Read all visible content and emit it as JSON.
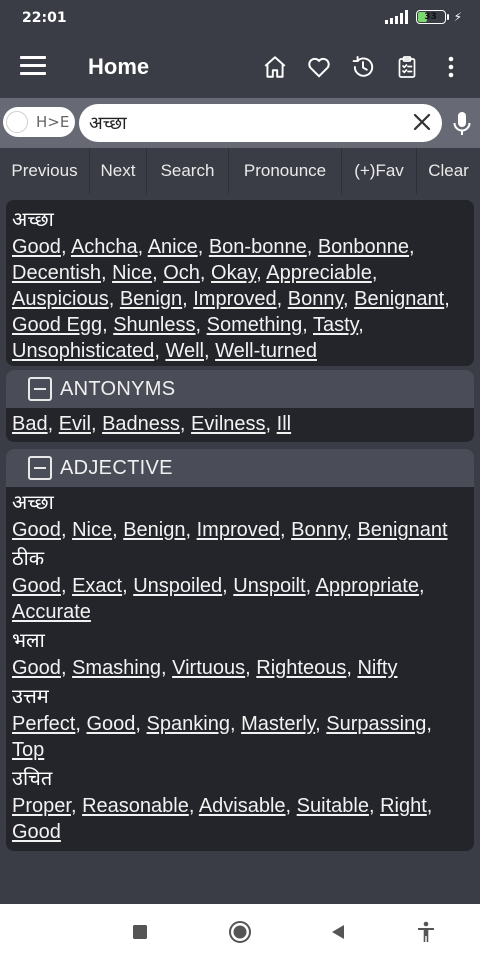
{
  "status": {
    "time": "22:01",
    "battery": "33",
    "battery_level": 0.33
  },
  "appbar": {
    "title": "Home"
  },
  "search": {
    "toggle_label": "H>E",
    "value": "अच्छा"
  },
  "tabs": [
    {
      "label": "Previous"
    },
    {
      "label": "Next"
    },
    {
      "label": "Search"
    },
    {
      "label": "Pronounce"
    },
    {
      "label": "(+)Fav"
    },
    {
      "label": "Clear"
    }
  ],
  "main": {
    "headword": "अच्छा",
    "translations": [
      "Good",
      "Achcha",
      "Anice",
      "Bon-bonne",
      "Bonbonne",
      "Decentish",
      "Nice",
      "Och",
      "Okay",
      "Appreciable",
      "Auspicious",
      "Benign",
      "Improved",
      "Bonny",
      "Benignant",
      "Good Egg",
      "Shunless",
      "Something",
      "Tasty",
      "Unsophisticated",
      "Well",
      "Well-turned"
    ]
  },
  "antonyms": {
    "heading": "ANTONYMS",
    "words": [
      "Bad",
      "Evil",
      "Badness",
      "Evilness",
      "Ill"
    ]
  },
  "adjective": {
    "heading": "ADJECTIVE",
    "groups": [
      {
        "hindi": "अच्छा",
        "words": [
          "Good",
          "Nice",
          "Benign",
          "Improved",
          "Bonny",
          "Benignant"
        ]
      },
      {
        "hindi": "ठीक",
        "words": [
          "Good",
          "Exact",
          "Unspoiled",
          "Unspoilt",
          "Appropriate",
          "Accurate"
        ]
      },
      {
        "hindi": "भला",
        "words": [
          "Good",
          "Smashing",
          "Virtuous",
          "Righteous",
          "Nifty"
        ]
      },
      {
        "hindi": "उत्तम",
        "words": [
          "Perfect",
          "Good",
          "Spanking",
          "Masterly",
          "Surpassing",
          "Top"
        ]
      },
      {
        "hindi": "उचित",
        "words": [
          "Proper",
          "Reasonable",
          "Advisable",
          "Suitable",
          "Right",
          "Good"
        ]
      }
    ]
  },
  "icons": {
    "appbar": [
      "menu-icon",
      "home-icon",
      "heart-icon",
      "history-icon",
      "clipboard-icon",
      "more-vert-icon"
    ],
    "navbar": [
      "recents-icon",
      "home-circle-icon",
      "back-icon",
      "accessibility-icon"
    ]
  }
}
